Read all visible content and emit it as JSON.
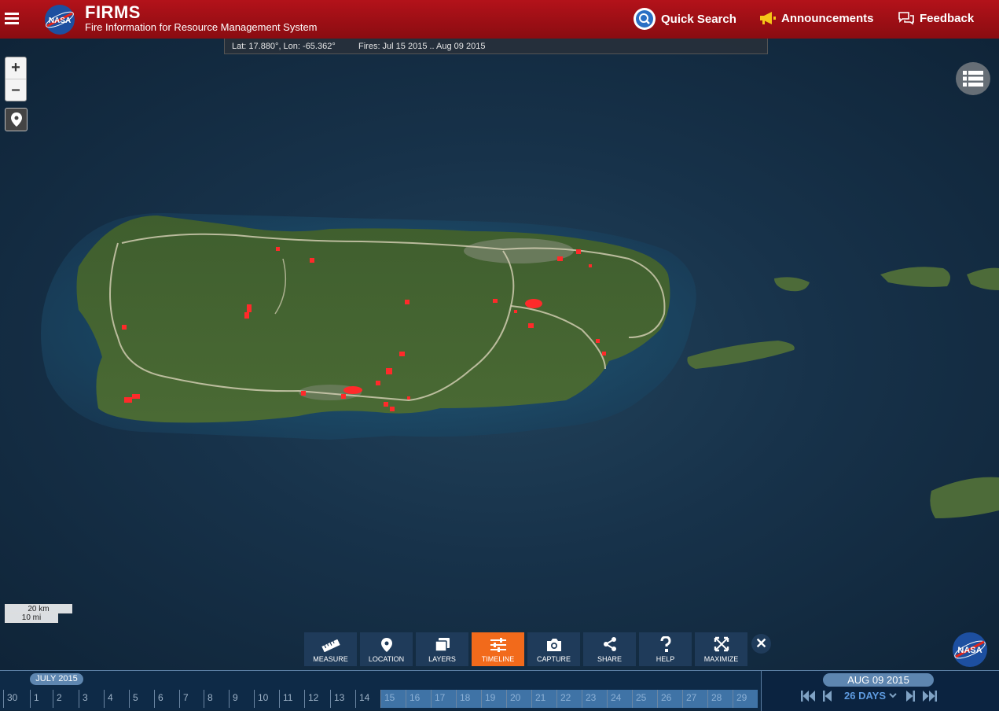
{
  "header": {
    "org_logo": "NASA",
    "title": "FIRMS",
    "subtitle": "Fire Information for Resource Management System",
    "quick_search": "Quick Search",
    "announcements": "Announcements",
    "feedback": "Feedback"
  },
  "map": {
    "coords": "Lat: 17.880°, Lon: -65.362°",
    "fires_range": "Fires: Jul 15 2015 .. Aug 09 2015",
    "zoom_in": "+",
    "zoom_out": "–",
    "scale_km": "20 km",
    "scale_mi": "10 mi",
    "fire_color": "#ff2a2a"
  },
  "toolbar": {
    "items": [
      {
        "label": "MEASURE",
        "icon": "ruler-icon"
      },
      {
        "label": "LOCATION",
        "icon": "map-pin-icon"
      },
      {
        "label": "LAYERS",
        "icon": "layers-icon"
      },
      {
        "label": "TIMELINE",
        "icon": "sliders-icon",
        "active": true
      },
      {
        "label": "CAPTURE",
        "icon": "camera-icon"
      },
      {
        "label": "SHARE",
        "icon": "share-icon"
      },
      {
        "label": "HELP",
        "icon": "help-icon"
      },
      {
        "label": "MAXIMIZE",
        "icon": "maximize-icon"
      }
    ],
    "close": "✕",
    "active_color": "#f26a1b"
  },
  "timeline": {
    "month": "JULY 2015",
    "days": [
      "30",
      "1",
      "2",
      "3",
      "4",
      "5",
      "6",
      "7",
      "8",
      "9",
      "10",
      "11",
      "12",
      "13",
      "14",
      "15",
      "16",
      "17",
      "18",
      "19",
      "20",
      "21",
      "22",
      "23",
      "24",
      "25",
      "26",
      "27",
      "28",
      "29"
    ],
    "selected_from": "15",
    "current_date": "AUG 09 2015",
    "range": "26 DAYS"
  }
}
